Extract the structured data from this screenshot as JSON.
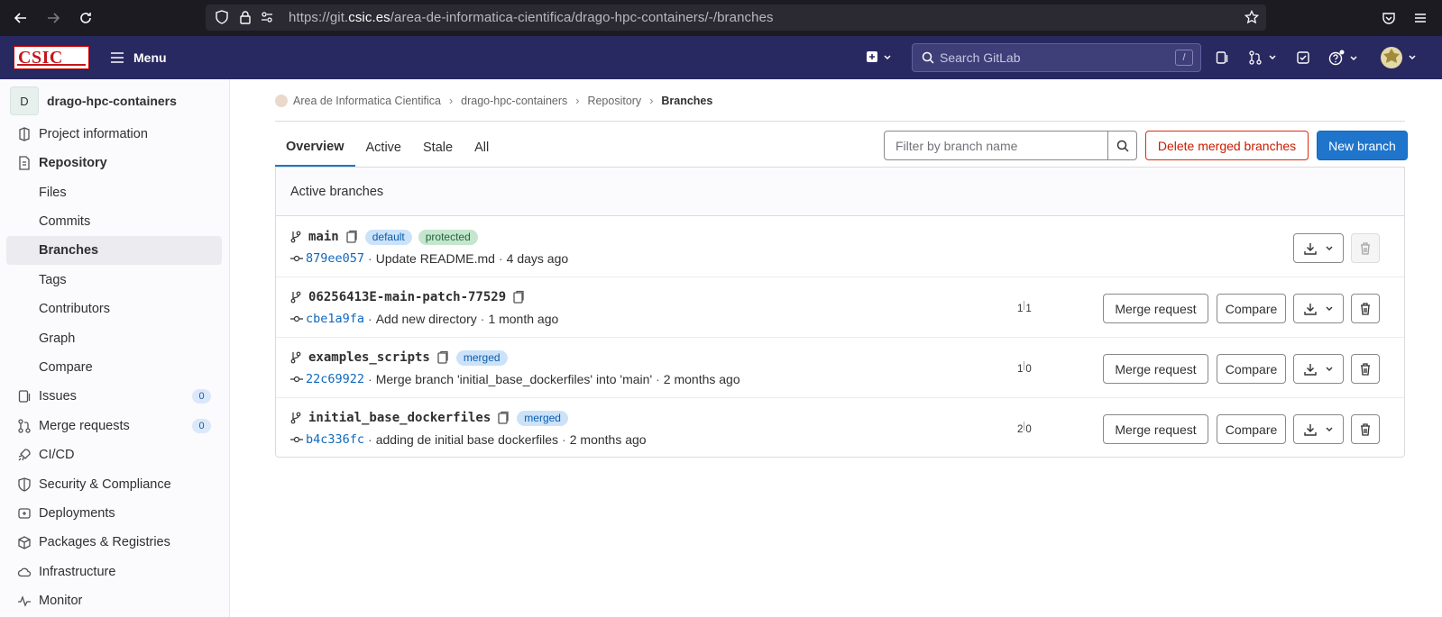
{
  "browser": {
    "url_prefix": "https://git.",
    "url_domain": "csic.es",
    "url_path": "/area-de-informatica-cientifica/drago-hpc-containers/-/branches"
  },
  "header": {
    "logo_text": "CSIC",
    "menu_label": "Menu",
    "search_placeholder": "Search GitLab",
    "search_shortcut": "/"
  },
  "sidebar": {
    "project_initial": "D",
    "project_name": "drago-hpc-containers",
    "items": [
      {
        "label": "Project information"
      },
      {
        "label": "Repository"
      },
      {
        "label": "Files"
      },
      {
        "label": "Commits"
      },
      {
        "label": "Branches"
      },
      {
        "label": "Tags"
      },
      {
        "label": "Contributors"
      },
      {
        "label": "Graph"
      },
      {
        "label": "Compare"
      },
      {
        "label": "Issues",
        "count": "0"
      },
      {
        "label": "Merge requests",
        "count": "0"
      },
      {
        "label": "CI/CD"
      },
      {
        "label": "Security & Compliance"
      },
      {
        "label": "Deployments"
      },
      {
        "label": "Packages & Registries"
      },
      {
        "label": "Infrastructure"
      },
      {
        "label": "Monitor"
      }
    ]
  },
  "breadcrumb": [
    "Area de Informatica Cientifica",
    "drago-hpc-containers",
    "Repository",
    "Branches"
  ],
  "tabs": [
    "Overview",
    "Active",
    "Stale",
    "All"
  ],
  "filter_placeholder": "Filter by branch name",
  "delete_merged_label": "Delete merged branches",
  "new_branch_label": "New branch",
  "panel_title": "Active branches",
  "branches": [
    {
      "name": "main",
      "badges": [
        "default",
        "protected"
      ],
      "sha": "879ee057",
      "message": "Update README.md",
      "time": "4 days ago"
    },
    {
      "name": "06256413E-main-patch-77529",
      "badges": [],
      "sha": "cbe1a9fa",
      "message": "Add new directory",
      "time": "1 month ago",
      "behind": "1",
      "ahead": "1"
    },
    {
      "name": "examples_scripts",
      "badges": [
        "merged"
      ],
      "sha": "22c69922",
      "message": "Merge branch 'initial_base_dockerfiles' into 'main'",
      "time": "2 months ago",
      "behind": "1",
      "ahead": "0"
    },
    {
      "name": "initial_base_dockerfiles",
      "badges": [
        "merged"
      ],
      "sha": "b4c336fc",
      "message": "adding de initial base dockerfiles",
      "time": "2 months ago",
      "behind": "2",
      "ahead": "0"
    }
  ],
  "row_buttons": {
    "merge_request": "Merge request",
    "compare": "Compare"
  },
  "sep": "·"
}
